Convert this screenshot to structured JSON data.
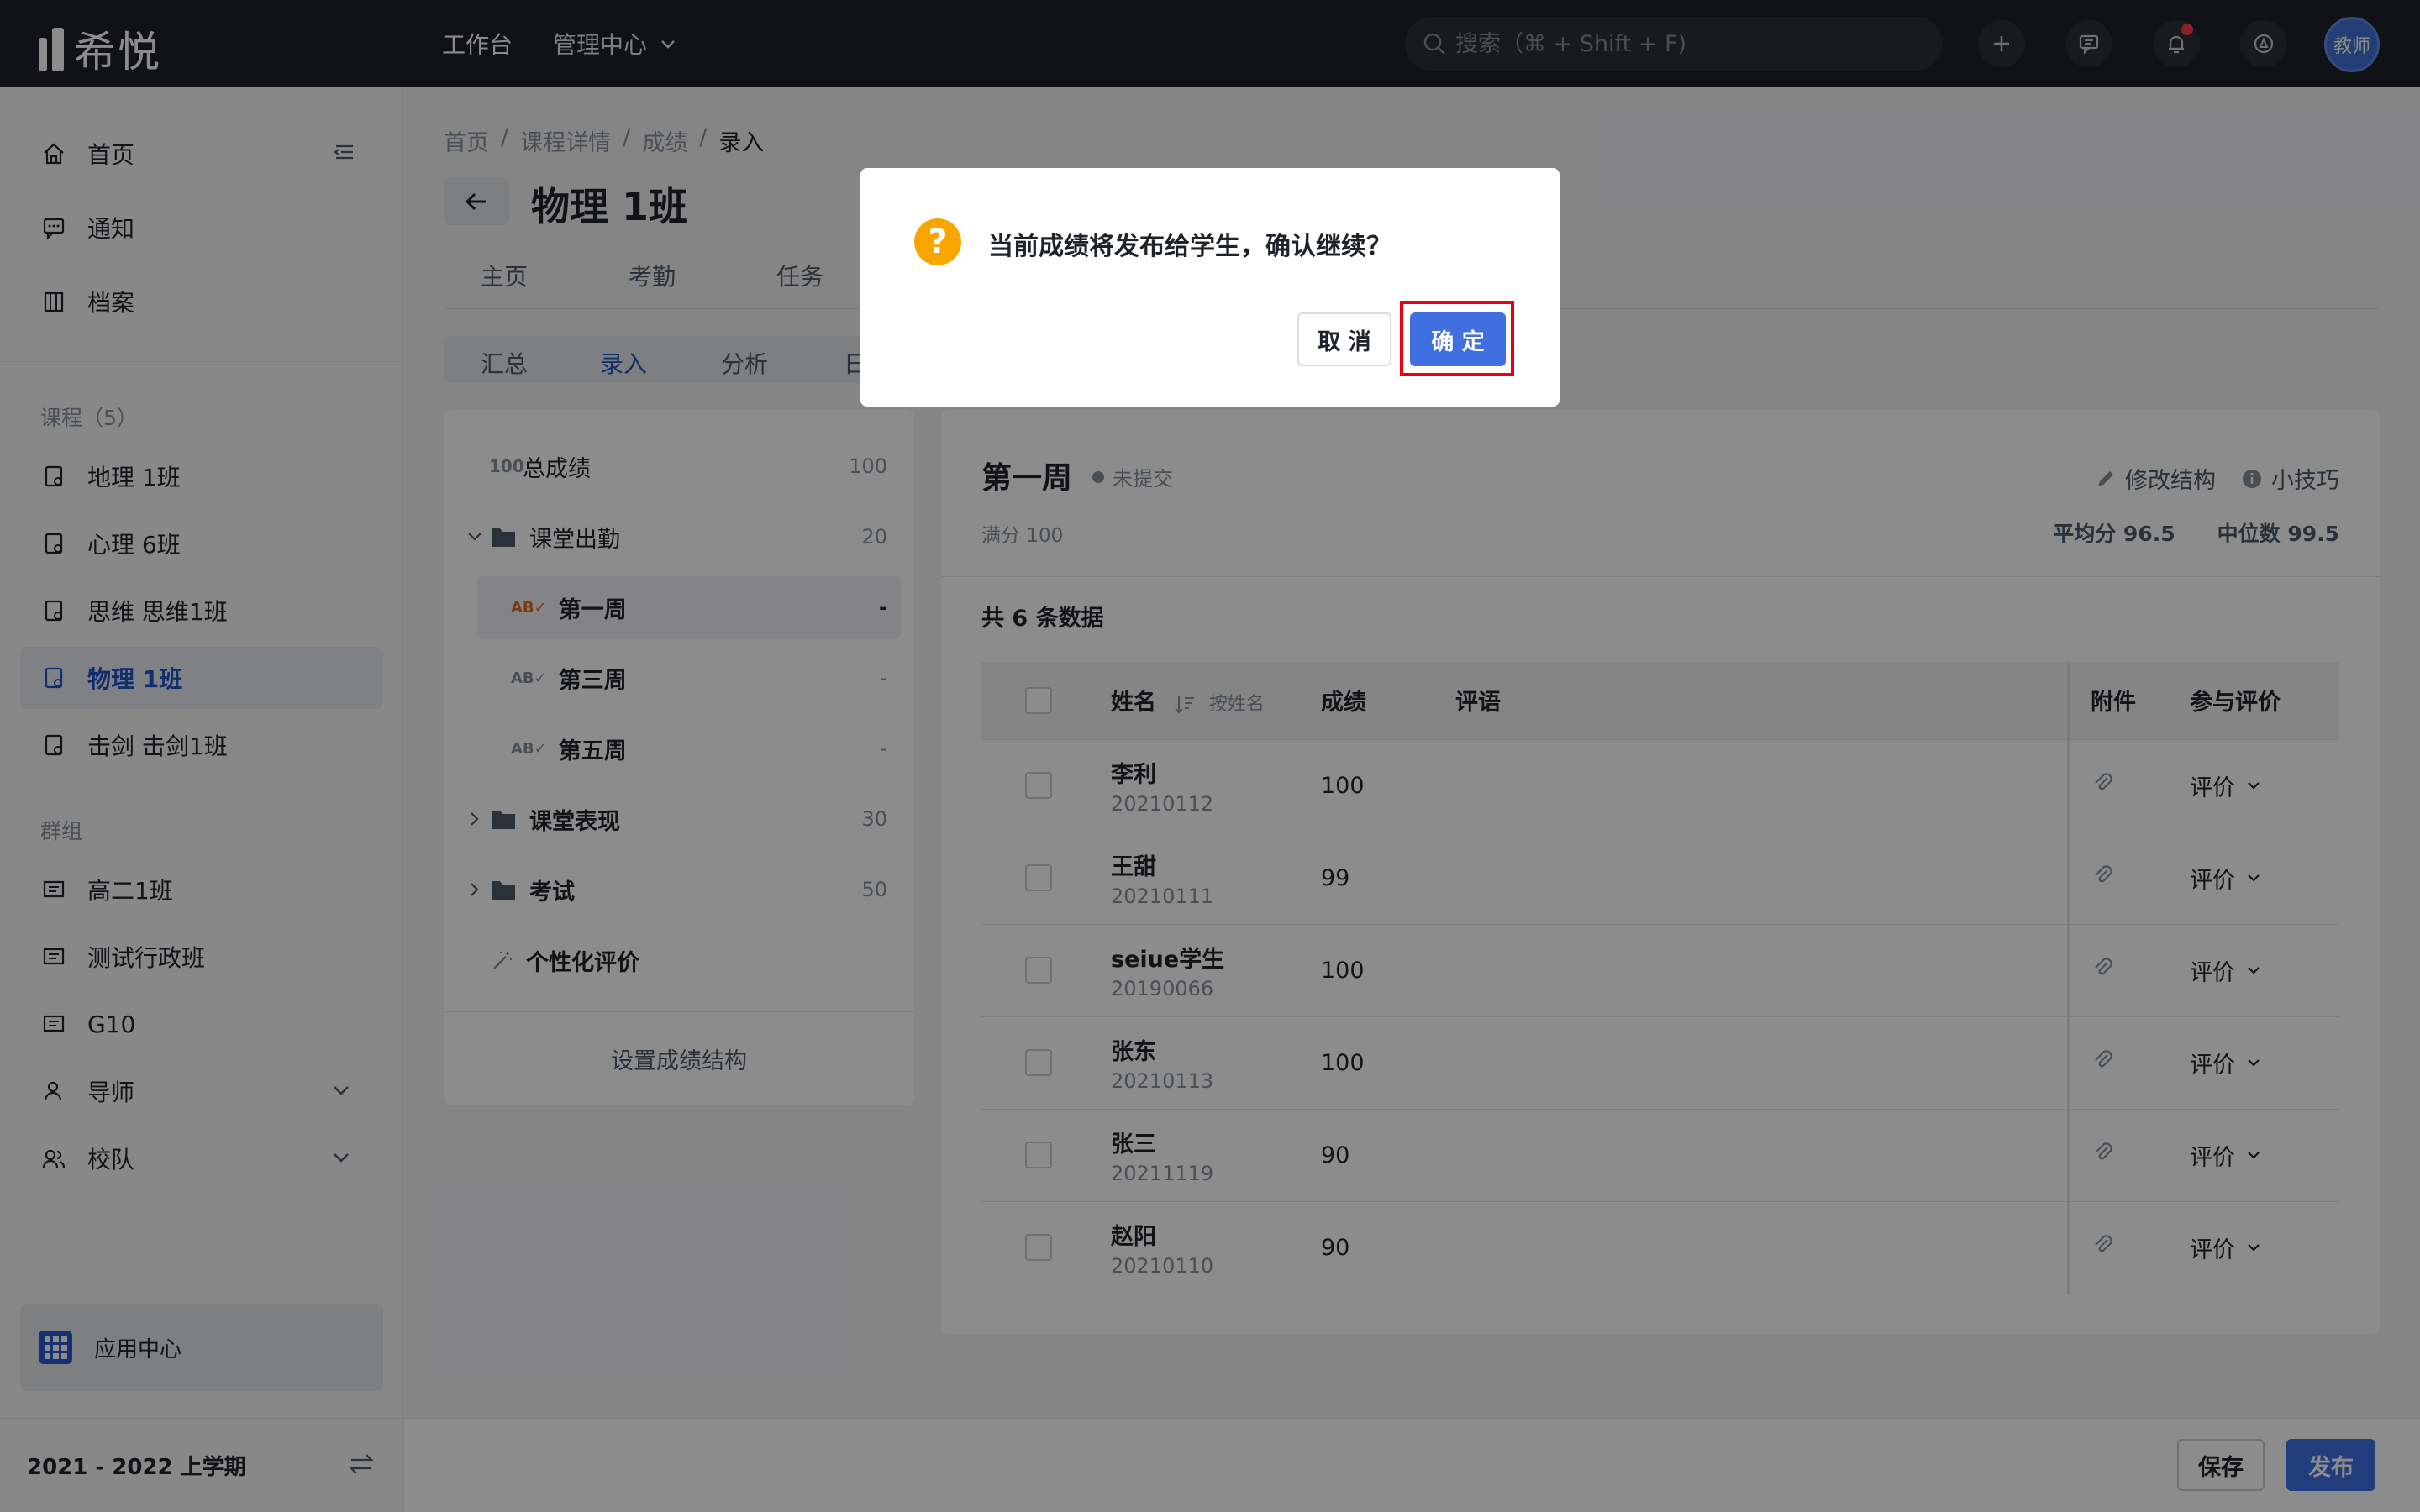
{
  "app": {
    "logo_text": "希悦"
  },
  "topnav": {
    "workbench": "工作台",
    "admin_center": "管理中心"
  },
  "search": {
    "placeholder": "搜索（⌘ + Shift + F)"
  },
  "user": {
    "avatar_label": "教师"
  },
  "sidebar": {
    "main_items": [
      {
        "label": "首页",
        "icon": "home-icon"
      },
      {
        "label": "通知",
        "icon": "message-icon"
      },
      {
        "label": "档案",
        "icon": "archive-icon"
      }
    ],
    "courses_label": "课程（5）",
    "courses": [
      {
        "label": "地理 1班"
      },
      {
        "label": "心理 6班"
      },
      {
        "label": "思维 思维1班"
      },
      {
        "label": "物理 1班",
        "active": true
      },
      {
        "label": "击剑 击剑1班"
      }
    ],
    "groups_label": "群组",
    "groups": [
      {
        "label": "高二1班"
      },
      {
        "label": "测试行政班"
      },
      {
        "label": "G10"
      },
      {
        "label": "导师"
      },
      {
        "label": "校队"
      }
    ],
    "app_center": "应用中心",
    "term": "2021 - 2022 上学期"
  },
  "breadcrumb": [
    "首页",
    "课程详情",
    "成绩",
    "录入"
  ],
  "page_title": "物理 1班",
  "tabs": [
    "主页",
    "考勤",
    "任务"
  ],
  "subtabs": [
    "汇总",
    "录入",
    "分析",
    "日"
  ],
  "tree": {
    "items": [
      {
        "label": "总成绩",
        "count": "100"
      },
      {
        "label": "课堂出勤",
        "count": "20"
      },
      {
        "label": "第一周",
        "count": "-"
      },
      {
        "label": "第三周",
        "count": "-"
      },
      {
        "label": "第五周",
        "count": "-"
      },
      {
        "label": "课堂表现",
        "count": "30"
      },
      {
        "label": "考试",
        "count": "50"
      },
      {
        "label": "个性化评价",
        "count": ""
      }
    ],
    "setup_label": "设置成绩结构"
  },
  "panel": {
    "title": "第一周",
    "status": "未提交",
    "edit_structure": "修改结构",
    "tips": "小技巧",
    "full_score": "满分 100",
    "average": "平均分 96.5",
    "median": "中位数 99.5",
    "count": "共 6 条数据"
  },
  "table": {
    "headers": {
      "name": "姓名",
      "sort": "按姓名",
      "score": "成绩",
      "comment": "评语",
      "attachment": "附件",
      "evaluate": "参与评价"
    },
    "eval_label": "评价",
    "rows": [
      {
        "name": "李利",
        "id": "20210112",
        "score": "100"
      },
      {
        "name": "王甜",
        "id": "20210111",
        "score": "99"
      },
      {
        "name": "seiue学生",
        "id": "20190066",
        "score": "100"
      },
      {
        "name": "张东",
        "id": "20210113",
        "score": "100"
      },
      {
        "name": "张三",
        "id": "20211119",
        "score": "90"
      },
      {
        "name": "赵阳",
        "id": "20210110",
        "score": "90"
      }
    ]
  },
  "bottom": {
    "save": "保存",
    "publish": "发布"
  },
  "modal": {
    "message": "当前成绩将发布给学生，确认继续？",
    "cancel": "取 消",
    "confirm": "确 定"
  },
  "colors": {
    "accent": "#3f6fe0",
    "topbar": "#1e2127",
    "warning": "#f7a600",
    "highlight_box": "#e60012"
  }
}
